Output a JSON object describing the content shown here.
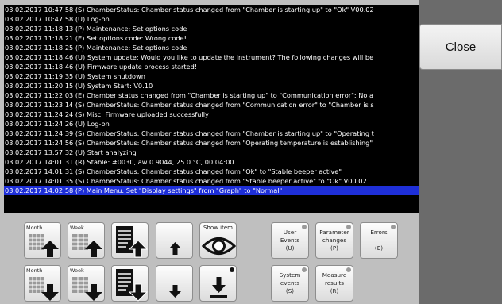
{
  "log": [
    "03.02.2017 10:47:58 (S) ChamberStatus: Chamber status changed from \"Chamber is starting up\" to \"Ok\" V00.02",
    "03.02.2017 10:47:58 (U) Log-on",
    "03.02.2017 11:18:13 (P) Maintenance: Set options code",
    "03.02.2017 11:18:21 (E) Set options code:  Wrong code!",
    "03.02.2017 11:18:25 (P) Maintenance: Set options code",
    "03.02.2017 11:18:46 (U) System update: Would you like to update the instrument? The following changes will be",
    "03.02.2017 11:18:46 (U) Firmware update process started!",
    "03.02.2017 11:19:35 (U) System shutdown",
    "03.02.2017 11:20:15 (U) System Start: V0.10",
    "03.02.2017 11:22:03 (E) Chamber status changed from \"Chamber is starting up\" to \"Communication error\": No a",
    "03.02.2017 11:23:14 (S) ChamberStatus: Chamber status changed from \"Communication error\" to \"Chamber is s",
    "03.02.2017 11:24:24 (S) Misc: Firmware uploaded successfully!",
    "03.02.2017 11:24:26 (U) Log-on",
    "03.02.2017 11:24:39 (S) ChamberStatus: Chamber status changed from \"Chamber is starting up\" to \"Operating t",
    "03.02.2017 11:24:56 (S) ChamberStatus: Chamber status changed from \"Operating temperature is establishing\"",
    "03.02.2017 13:57:32 (U) Start analyzing",
    "03.02.2017 14:01:31 (R) Stable: #0030, aw 0.9044, 25.0 °C, 00:04:00",
    "03.02.2017 14:01:31 (S) ChamberStatus: Chamber status changed from \"Ok\" to \"Stable beeper active\"",
    "03.02.2017 14:01:35 (S) ChamberStatus: Chamber status changed from \"Stable beeper active\" to \"Ok\" V00.02",
    "03.02.2017 14:02:58 (P) Main Menu: Set \"Display settings\" from \"Graph\" to \"Normal\""
  ],
  "selected_index": 19,
  "close_label": "Close",
  "buttons": {
    "month_label": "Month",
    "week_label": "Week",
    "show_item_label": "Show item",
    "user_events": "User\nEvents\n(U)",
    "parameter_changes": "Parameter\nchanges\n(P)",
    "errors": "Errors\n\n(E)",
    "system_events": "System\nevents\n(S)",
    "measure_results": "Measure\nresults\n(R)"
  },
  "colors": {
    "log_bg": "#000000",
    "selected_row": "#1e2fd8",
    "panel": "#6b6b6b",
    "body": "#bfbfbf"
  }
}
